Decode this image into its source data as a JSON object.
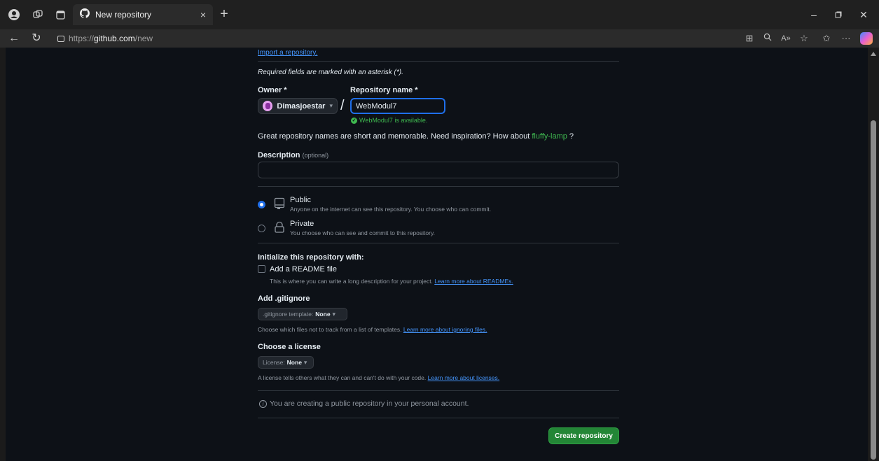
{
  "browser": {
    "tab_title": "New repository",
    "tab_close": "×",
    "new_tab": "+",
    "url_prefix": "https://",
    "url_host": "github.com",
    "url_path": "/new",
    "icons": [
      "profile-icon",
      "workspaces-icon",
      "tab-actions-icon",
      "github-icon",
      "back-icon",
      "refresh-icon",
      "lock-icon",
      "split-screen-icon",
      "zoom-icon",
      "read-aloud-icon",
      "favorite-icon",
      "favorites-bar-icon",
      "more-icon",
      "copilot-icon"
    ]
  },
  "form": {
    "import_link": "Import a repository.",
    "required_note": "Required fields are marked with an asterisk (*).",
    "owner_label": "Owner *",
    "owner_name": "Dimasjoestar",
    "repo_label": "Repository name *",
    "repo_value": "WebModul7",
    "availability": "WebModul7 is available.",
    "inspire_prefix": "Great repository names are short and memorable. Need inspiration? How about ",
    "inspire_suggestion": "fluffy-lamp",
    "inspire_suffix": " ?",
    "description_label": "Description",
    "description_optional": "(optional)",
    "description_value": "",
    "visibility": {
      "selected": "Public",
      "public_title": "Public",
      "public_desc": "Anyone on the internet can see this repository. You choose who can commit.",
      "private_title": "Private",
      "private_desc": "You choose who can see and commit to this repository."
    },
    "init_label": "Initialize this repository with:",
    "readme_label": "Add a README file",
    "readme_checked": false,
    "readme_desc_prefix": "This is where you can write a long description for your project. ",
    "readme_link": "Learn more about READMEs.",
    "gitignore_label": "Add .gitignore",
    "gitignore_select_prefix": ".gitignore template: ",
    "gitignore_select_value": "None",
    "gitignore_desc_prefix": "Choose which files not to track from a list of templates. ",
    "gitignore_link": "Learn more about ignoring files.",
    "license_label": "Choose a license",
    "license_select_prefix": "License: ",
    "license_select_value": "None",
    "license_desc_prefix": "A license tells others what they can and can't do with your code. ",
    "license_link": "Learn more about licenses.",
    "notice": "You are creating a public repository in your personal account.",
    "create_button": "Create repository"
  },
  "colors": {
    "background": "#0d1117",
    "accent_blue": "#1f6feb",
    "link_blue": "#4493f8",
    "success_green": "#3fb950",
    "button_green": "#238636"
  }
}
